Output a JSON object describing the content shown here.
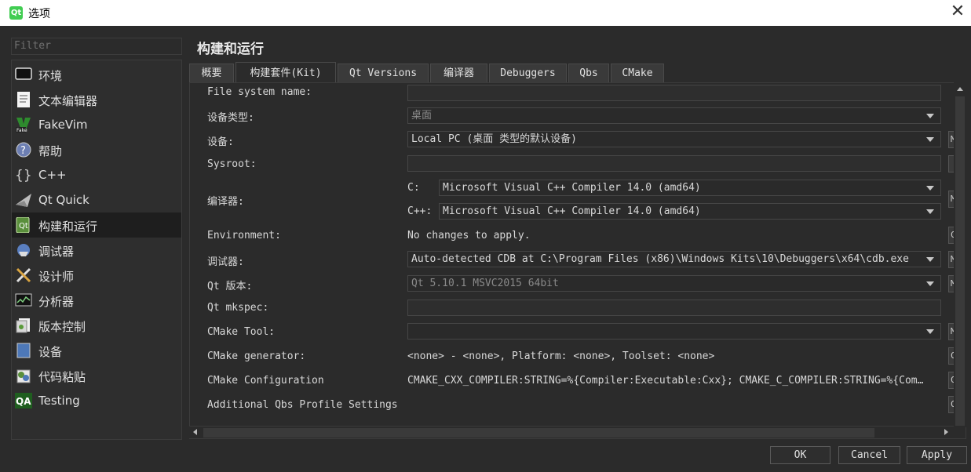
{
  "window": {
    "title": "选项",
    "logo_text": "Qt",
    "close_glyph": "✕"
  },
  "sidebar": {
    "filter_placeholder": "Filter",
    "items": [
      {
        "label": "环境",
        "icon": "monitor-icon"
      },
      {
        "label": "文本编辑器",
        "icon": "text-editor-icon"
      },
      {
        "label": "FakeVim",
        "icon": "fakevim-icon"
      },
      {
        "label": "帮助",
        "icon": "help-icon"
      },
      {
        "label": "C++",
        "icon": "cpp-braces-icon"
      },
      {
        "label": "Qt Quick",
        "icon": "qt-quick-icon"
      },
      {
        "label": "构建和运行",
        "icon": "build-run-icon",
        "selected": true
      },
      {
        "label": "调试器",
        "icon": "debugger-icon"
      },
      {
        "label": "设计师",
        "icon": "designer-icon"
      },
      {
        "label": "分析器",
        "icon": "analyzer-icon"
      },
      {
        "label": "版本控制",
        "icon": "version-control-icon"
      },
      {
        "label": "设备",
        "icon": "device-icon"
      },
      {
        "label": "代码粘贴",
        "icon": "code-paste-icon"
      },
      {
        "label": "Testing",
        "icon": "qa-testing-icon",
        "icon_text": "QA"
      }
    ]
  },
  "main": {
    "title": "构建和运行",
    "tabs": [
      "概要",
      "构建套件(Kit)",
      "Qt Versions",
      "编译器",
      "Debuggers",
      "Qbs",
      "CMake"
    ],
    "active_tab": "构建套件(Kit)",
    "form": {
      "file_system_name": {
        "label": "File system name:",
        "value": ""
      },
      "device_type": {
        "label": "设备类型:",
        "value": "桌面"
      },
      "device": {
        "label": "设备:",
        "value": "Local PC (桌面 类型的默认设备)",
        "side_button": "M"
      },
      "sysroot": {
        "label": "Sysroot:",
        "value": ""
      },
      "compiler": {
        "label": "编译器:",
        "c_label": "C:",
        "c_value": "Microsoft Visual C++ Compiler 14.0 (amd64)",
        "cpp_label": "C++:",
        "cpp_value": "Microsoft Visual C++ Compiler 14.0 (amd64)",
        "side_button": "M"
      },
      "environment": {
        "label": "Environment:",
        "value": "No changes to apply.",
        "side_button": "C"
      },
      "debugger": {
        "label": "调试器:",
        "value": "Auto-detected CDB at C:\\Program Files (x86)\\Windows Kits\\10\\Debuggers\\x64\\cdb.exe",
        "side_button": "M"
      },
      "qt_version": {
        "label": "Qt 版本:",
        "value": "Qt 5.10.1 MSVC2015 64bit",
        "side_button": "M"
      },
      "qt_mkspec": {
        "label": "Qt mkspec:",
        "value": ""
      },
      "cmake_tool": {
        "label": "CMake Tool:",
        "value": "",
        "side_button": "M"
      },
      "cmake_generator": {
        "label": "CMake generator:",
        "value": "<none> - <none>, Platform: <none>, Toolset: <none>",
        "side_button": "C"
      },
      "cmake_configuration": {
        "label": "CMake Configuration",
        "value": "CMAKE_CXX_COMPILER:STRING=%{Compiler:Executable:Cxx}; CMAKE_C_COMPILER:STRING=%{Com…",
        "side_button": "C"
      },
      "additional_qbs": {
        "label": "Additional Qbs Profile Settings",
        "side_button": "C"
      }
    }
  },
  "buttons": {
    "ok": "OK",
    "cancel": "Cancel",
    "apply": "Apply"
  }
}
